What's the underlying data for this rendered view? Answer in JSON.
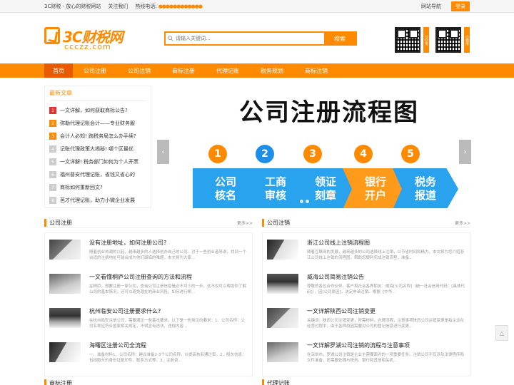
{
  "topbar": {
    "slogan": "3C财税 - 放心的财税网站",
    "follow": "关注我们",
    "hotline_label": "热线电话:",
    "hotline_value": "●●●●●●●●●●●●",
    "site_nav": "网站导航",
    "login": "登录"
  },
  "header": {
    "logo_text": "3C财税网",
    "logo_sub": "ccczz.com",
    "search_placeholder": "请输入关键词...",
    "search_button": "搜索",
    "qr_tag_1": "公众号",
    "qr_tag_2": "小程序"
  },
  "nav": {
    "items": [
      "首页",
      "公司注册",
      "公司注销",
      "商标注册",
      "代理记账",
      "税务规划",
      "商标注销"
    ]
  },
  "latest": {
    "title": "最新文章",
    "items": [
      {
        "num": "1",
        "text": "一文详解，如何获取商标公告?"
      },
      {
        "num": "2",
        "text": "弥勒代理记账会计——专业财务服"
      },
      {
        "num": "3",
        "text": "会计人必知! 跑税务局怎么办手续?"
      },
      {
        "num": "4",
        "text": "记账代理政策大揭秘! 哪个区最优"
      },
      {
        "num": "5",
        "text": "一文详解! 税务部门如何为个人开票"
      },
      {
        "num": "6",
        "text": "福州普安代理记账，省钱又省心的"
      },
      {
        "num": "7",
        "text": "商标如何重新回文?"
      },
      {
        "num": "8",
        "text": "芭才代理记账，助力小微企业发展"
      }
    ]
  },
  "banner": {
    "title": "公司注册流程图",
    "steps": [
      {
        "num": "1",
        "label": "公司核名"
      },
      {
        "num": "2",
        "label": "工商审核"
      },
      {
        "num": "3",
        "label": "领证刻章"
      },
      {
        "num": "4",
        "label": "银行开户"
      },
      {
        "num": "5",
        "label": "税务报道"
      }
    ],
    "prev": "‹",
    "next": "›"
  },
  "sections": {
    "left": {
      "title": "公司注册",
      "more": "更多>>",
      "articles": [
        {
          "title": "没有注册地址，如何注册公司?",
          "excerpt": "随着创业热潮的兴起，越来越多的人选择创办自己的公司。对于一些创业者来说，找到一个合适的注册地址可能会成为他们面临的难题。本文将为大家..."
        },
        {
          "title": "一文看懂桐庐公司注册查询的方法和流程",
          "excerpt": "在桐庐，想要注册一家公司，查询公司注册信息是必不可少的一步。这不仅可以帮助你了解公司的基本情况，还可以避免潜在的商业风险。如何进行桐..."
        },
        {
          "title": "杭州临安公司注册要求什么?",
          "excerpt": "在杭州临安注册公司，需要满足一些基本要求。以下是一些常见的要求：1、公司名称：公司名称应符合国家相关规定，不得含有违法、违规内容..."
        },
        {
          "title": "海曙区注册公司全流程",
          "excerpt": "一、准备材料1、公司名称：建议准备2-3个公司名称，以提高核名通过率。2、股东信息：包括股东的身份证复印件、联系方式等。3、注册资..."
        }
      ]
    },
    "right": {
      "title": "公司注销",
      "more": "更多>>",
      "articles": [
        {
          "title": "浙江公司线上注销流程图",
          "excerpt": "随着互联网的发展，越来越多的公司选择线上注销，以节省时间和精力。本文将为您介绍浙江公司线上注销的流程图，帮助您顺利完成注销流程，准备..."
        },
        {
          "title": "威海公司简易注销公告",
          "excerpt": "尊敬的各位合作伙伴、客户和社会各界朋友：威海[公司名称]（统一社会信用代码：[具体代码]），因[公司原因]，决定申请注销。根据《中华..."
        },
        {
          "title": "一文详解陕西公司注销变更",
          "excerpt": "关键词：陕西公司注销变更，所需材料，办理流程，注意事项陕西公司注销变更是指企业在经营过程中，由于各种原因需要对公司的登记信息进行变更..."
        },
        {
          "title": "一文详解罗湖公司注销的流程与注意事项",
          "excerpt": "在深圳市，罗湖公司注销是企业主需要面对的一项重要任务。注销公司不仅涉及法律程序和文件准备，还需要处理与税务、银行和其他相关机..."
        }
      ]
    }
  },
  "bottom": {
    "left_title": "商标注册",
    "right_title": "代理记账"
  },
  "float_top": "△"
}
